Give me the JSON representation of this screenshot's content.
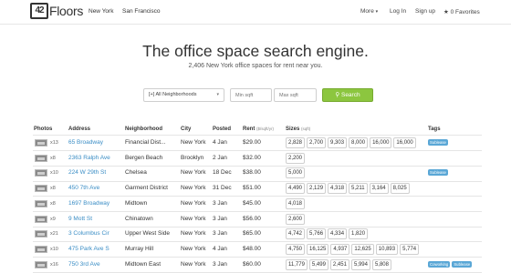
{
  "nav": {
    "logo_text": "Floors",
    "logo_mark": "42",
    "cities": [
      "New York",
      "San Francisco"
    ],
    "more": "More",
    "login": "Log In",
    "signup": "Sign up",
    "favorites": "0 Favorites"
  },
  "hero": {
    "title": "The office space search engine.",
    "subtitle": "2,406 New York office spaces for rent near you."
  },
  "search": {
    "neighborhoods": "[+] All Neighborhoods",
    "min_placeholder": "Min sqft",
    "max_placeholder": "Max sqft",
    "button": "Search"
  },
  "table": {
    "headers": {
      "photos": "Photos",
      "address": "Address",
      "neighborhood": "Neighborhood",
      "city": "City",
      "posted": "Posted",
      "rent": "Rent",
      "rent_unit": "($/sqft/yr)",
      "sizes": "Sizes",
      "sizes_unit": "(sqft)",
      "tags": "Tags"
    },
    "rows": [
      {
        "count": "x13",
        "address": "65 Broadway",
        "neighborhood": "Financial Dist...",
        "city": "New York",
        "posted": "4 Jan",
        "rent": "$29.00",
        "sizes": [
          "2,828",
          "2,700",
          "9,303",
          "8,000",
          "16,000",
          "16,000"
        ],
        "tags": [
          "Sublease"
        ]
      },
      {
        "count": "x8",
        "address": "2363 Ralph Ave",
        "neighborhood": "Bergen Beach",
        "city": "Brooklyn",
        "posted": "2 Jan",
        "rent": "$32.00",
        "sizes": [
          "2,200"
        ],
        "tags": []
      },
      {
        "count": "x10",
        "address": "224 W 29th St",
        "neighborhood": "Chelsea",
        "city": "New York",
        "posted": "18 Dec",
        "rent": "$38.00",
        "sizes": [
          "5,000"
        ],
        "tags": [
          "Sublease"
        ]
      },
      {
        "count": "x8",
        "address": "450 7th Ave",
        "neighborhood": "Garment District",
        "city": "New York",
        "posted": "31 Dec",
        "rent": "$51.00",
        "sizes": [
          "4,490",
          "2,129",
          "4,318",
          "5,211",
          "3,164",
          "8,025"
        ],
        "tags": []
      },
      {
        "count": "x8",
        "address": "1697 Broadway",
        "neighborhood": "Midtown",
        "city": "New York",
        "posted": "3 Jan",
        "rent": "$45.00",
        "sizes": [
          "4,018"
        ],
        "tags": []
      },
      {
        "count": "x9",
        "address": "9 Mott St",
        "neighborhood": "Chinatown",
        "city": "New York",
        "posted": "3 Jan",
        "rent": "$56.00",
        "sizes": [
          "2,600"
        ],
        "tags": []
      },
      {
        "count": "x21",
        "address": "3 Columbus Cir",
        "neighborhood": "Upper West Side",
        "city": "New York",
        "posted": "3 Jan",
        "rent": "$65.00",
        "sizes": [
          "4,742",
          "5,766",
          "4,334",
          "1,820"
        ],
        "tags": []
      },
      {
        "count": "x10",
        "address": "475 Park Ave S",
        "neighborhood": "Murray Hill",
        "city": "New York",
        "posted": "4 Jan",
        "rent": "$48.00",
        "sizes": [
          "4,750",
          "16,125",
          "4,937",
          "12,625",
          "10,893",
          "5,774"
        ],
        "tags": []
      },
      {
        "count": "x16",
        "address": "750 3rd Ave",
        "neighborhood": "Midtown East",
        "city": "New York",
        "posted": "3 Jan",
        "rent": "$60.00",
        "sizes": [
          "11,779",
          "5,499",
          "2,451",
          "5,994",
          "5,808"
        ],
        "tags": [
          "Coworking",
          "Sublease"
        ]
      }
    ]
  },
  "colors": {
    "link": "#3a8dc5",
    "search_button": "#8cc63f",
    "tag": "#5aa7d6"
  },
  "icons": {
    "star": "star-icon",
    "more_caret": "caret-down-icon",
    "search": "search-icon"
  }
}
